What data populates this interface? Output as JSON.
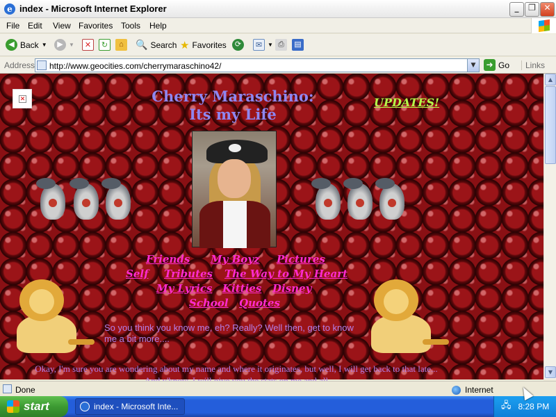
{
  "window": {
    "title": "index - Microsoft Internet Explorer",
    "controls": {
      "minimize": "_",
      "restore": "❐",
      "close": "✕"
    }
  },
  "menu": [
    "File",
    "Edit",
    "View",
    "Favorites",
    "Tools",
    "Help"
  ],
  "toolbar": {
    "back": "Back",
    "search": "Search",
    "favorites": "Favorites"
  },
  "address": {
    "label": "Address",
    "url": "http://www.geocities.com/cherrymaraschino42/",
    "go": "Go",
    "links": "Links"
  },
  "page": {
    "title_line1": "Cherry Maraschino:",
    "title_line2": "Its my Life",
    "updates": "UPDATES!",
    "nav": {
      "row1": [
        "Friends",
        "My Boyz",
        "Pictures"
      ],
      "row2": [
        "Self",
        "Tributes",
        "The Way to My Heart"
      ],
      "row3": [
        "My Lyrics",
        "Kitties",
        "Disney"
      ],
      "row4": [
        "School",
        "Quotes"
      ]
    },
    "intro": "So you think you know me, eh?  Really? Well then, get to know me a bit more....",
    "paragraph": "Okay, I'm sure you are wondering about my name and where it originates, but well, I will get back to that late... And y'know, I will give you the stats on me and all"
  },
  "status": {
    "text": "Done",
    "zone": "Internet"
  },
  "taskbar": {
    "start": "start",
    "task": "index - Microsoft Inte...",
    "clock": "8:28 PM"
  },
  "colors": {
    "title": "#8f86f0",
    "updates": "#b6ff49",
    "nav_links": "#ff2bd0",
    "body_text": "#b47fe8",
    "background": "#4a0a0a"
  }
}
